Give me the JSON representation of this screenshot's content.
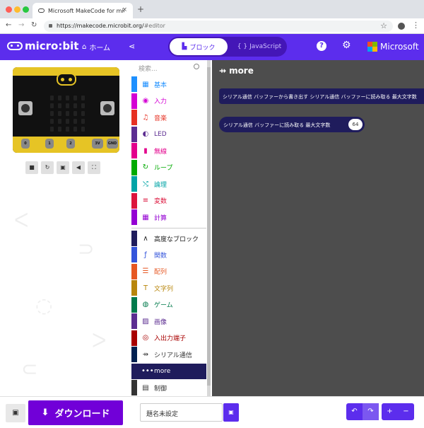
{
  "browser": {
    "tab_title": "Microsoft MakeCode for micro:bit",
    "tab_close": "×",
    "new_tab": "+",
    "back": "←",
    "forward": "→",
    "reload": "↻",
    "url_host": "https://makecode.microbit.org/",
    "url_path": "#editor",
    "star": "☆",
    "menu": "⋮"
  },
  "header": {
    "logo_text": "micro:bit",
    "home_label": "ホーム",
    "share_icon": "⟨",
    "blocks_label": "ブロック",
    "js_label": "JavaScript",
    "help_icon": "?",
    "settings_icon": "⚙",
    "microsoft_label": "Microsoft",
    "accent": "#5c2ded"
  },
  "simulator": {
    "pins": [
      "0",
      "1",
      "2",
      "3V",
      "GND"
    ],
    "tools": [
      "■",
      "↻",
      "▣",
      "◀",
      "⛶"
    ]
  },
  "toolbox": {
    "search_placeholder": "検索...",
    "items": [
      {
        "label": "基本",
        "color": "#1e90ff",
        "icon": "▦"
      },
      {
        "label": "入力",
        "color": "#d400d4",
        "icon": "◉"
      },
      {
        "label": "音楽",
        "color": "#e63022",
        "icon": "♫"
      },
      {
        "label": "LED",
        "color": "#5c2d91",
        "icon": "◐"
      },
      {
        "label": "無線",
        "color": "#e3008c",
        "icon": "▮"
      },
      {
        "label": "ループ",
        "color": "#00aa00",
        "icon": "↻"
      },
      {
        "label": "論理",
        "color": "#00a4a6",
        "icon": "⤭"
      },
      {
        "label": "変数",
        "color": "#dc143c",
        "icon": "≡"
      },
      {
        "label": "計算",
        "color": "#9400d3",
        "icon": "▦"
      }
    ],
    "advanced_label": "高度なブロック",
    "advanced_icon": "∧",
    "advanced_items": [
      {
        "label": "関数",
        "color": "#3455db",
        "icon": "ƒ"
      },
      {
        "label": "配列",
        "color": "#e65722",
        "icon": "☰"
      },
      {
        "label": "文字列",
        "color": "#b8860b",
        "icon": "T"
      },
      {
        "label": "ゲーム",
        "color": "#007a4b",
        "icon": "◍"
      },
      {
        "label": "画像",
        "color": "#5c2d91",
        "icon": "▨"
      },
      {
        "label": "入出力端子",
        "color": "#a80000",
        "icon": "◎"
      },
      {
        "label": "シリアル通信",
        "color": "#002050",
        "icon": "⇸"
      },
      {
        "label": "more",
        "color": "#1f1c5c",
        "icon": "•••"
      },
      {
        "label": "制御",
        "color": "#333333",
        "icon": "▤"
      }
    ]
  },
  "workspace": {
    "heading": "more",
    "heading_icon": "⇸",
    "block1": "シリアル通信 バッファーから書き出す  シリアル通信 バッファーに読み取る 最大文字数",
    "block2_text": "シリアル通信 バッファーに読み取る 最大文字数",
    "block2_value": "64"
  },
  "footer": {
    "download_label": "ダウンロード",
    "download_icon": "⬇",
    "project_name": "題名未設定",
    "collapse_icon": "▣",
    "save_icon": "▣",
    "undo_icon": "↶",
    "redo_icon": "↷",
    "zoom_in_icon": "+",
    "zoom_out_icon": "−"
  }
}
